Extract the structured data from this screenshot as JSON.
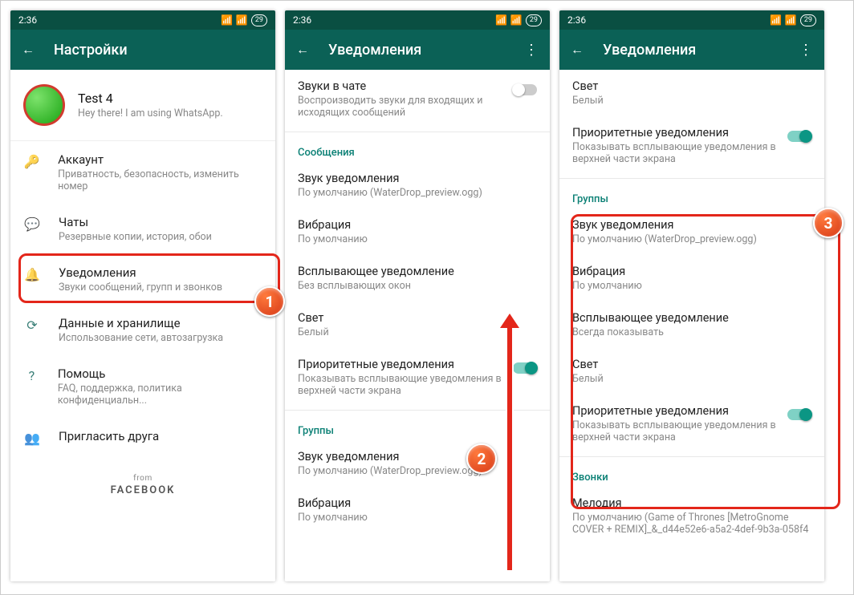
{
  "status": {
    "time": "2:36",
    "battery": "29"
  },
  "screen1": {
    "title": "Настройки",
    "profile": {
      "name": "Test 4",
      "status": "Hey there! I am using WhatsApp."
    },
    "items": [
      {
        "title": "Аккаунт",
        "sub": "Приватность, безопасность, изменить номер"
      },
      {
        "title": "Чаты",
        "sub": "Резервные копии, история, обои"
      },
      {
        "title": "Уведомления",
        "sub": "Звуки сообщений, групп и звонков"
      },
      {
        "title": "Данные и хранилище",
        "sub": "Использование сети, автозагрузка"
      },
      {
        "title": "Помощь",
        "sub": "FAQ, поддержка, политика конфиденциальн..."
      },
      {
        "title": "Пригласить друга",
        "sub": ""
      }
    ],
    "from": "from",
    "facebook": "FACEBOOK"
  },
  "screen2": {
    "title": "Уведомления",
    "chatSounds": {
      "title": "Звуки в чате",
      "sub": "Воспроизводить звуки для входящих и исходящих сообщений"
    },
    "sections": {
      "messages": "Сообщения",
      "groups": "Группы"
    },
    "rows": {
      "sound": {
        "title": "Звук уведомления",
        "sub": "По умолчанию (WaterDrop_preview.ogg)"
      },
      "vibr": {
        "title": "Вибрация",
        "sub": "По умолчанию"
      },
      "popup": {
        "title": "Всплывающее уведомление",
        "sub": "Без всплывающих окон"
      },
      "light": {
        "title": "Свет",
        "sub": "Белый"
      },
      "priority": {
        "title": "Приоритетные уведомления",
        "sub": "Показывать всплывающие уведомления в верхней части экрана"
      }
    }
  },
  "screen3": {
    "title": "Уведомления",
    "sections": {
      "groups": "Группы",
      "calls": "Звонки"
    },
    "light": {
      "title": "Свет",
      "sub": "Белый"
    },
    "priority": {
      "title": "Приоритетные уведомления",
      "sub": "Показывать всплывающие уведомления в верхней части экрана"
    },
    "rows": {
      "sound": {
        "title": "Звук уведомления",
        "sub": "По умолчанию (WaterDrop_preview.ogg)"
      },
      "vibr": {
        "title": "Вибрация",
        "sub": "По умолчанию"
      },
      "popup": {
        "title": "Всплывающее уведомление",
        "sub": "Всегда показывать"
      },
      "light": {
        "title": "Свет",
        "sub": "Белый"
      },
      "priority": {
        "title": "Приоритетные уведомления",
        "sub": "Показывать всплывающие уведомления в верхней части экрана"
      },
      "ringtone": {
        "title": "Мелодия",
        "sub": "По умолчанию (Game of Thrones [MetroGnome COVER + REMIX]_&_d44e52e6-a5a2-4def-9b3a-058f4"
      }
    }
  },
  "markers": {
    "m1": "1",
    "m2": "2",
    "m3": "3"
  }
}
